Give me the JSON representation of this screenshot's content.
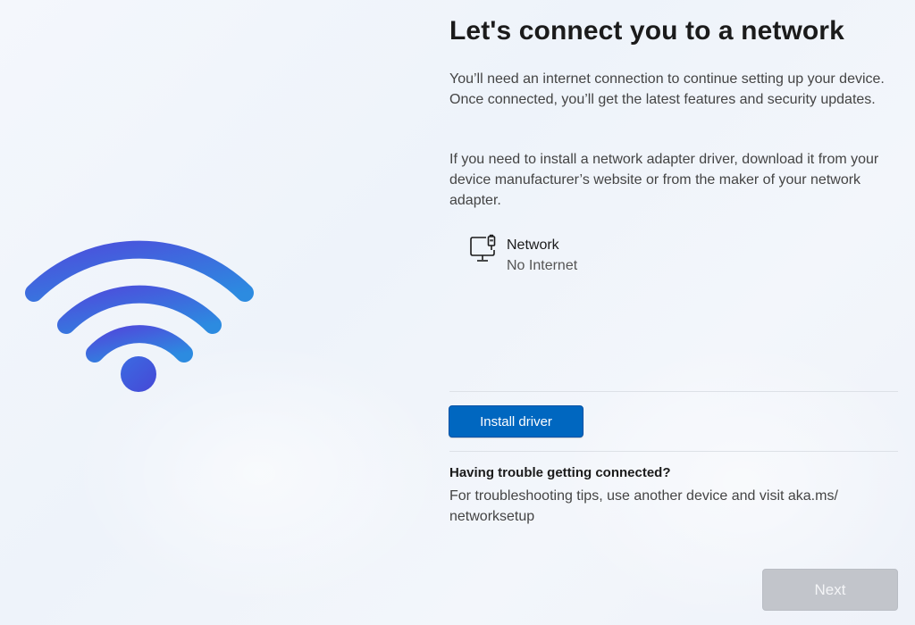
{
  "page": {
    "title": "Let's connect you to a network",
    "paragraph_1": "You’ll need an internet connection to continue setting up your device. Once connected, you’ll get the latest features and security updates.",
    "paragraph_2": "If you need to install a network adapter driver, download it from your device manufacturer’s website or from the maker of your network adapter."
  },
  "network": {
    "icon": "ethernet-monitor-icon",
    "name": "Network",
    "status": "No Internet"
  },
  "install_driver": {
    "label": "Install driver"
  },
  "troubleshoot": {
    "heading": "Having trouble getting connected?",
    "text": "For troubleshooting tips, use another device and visit aka.ms/ networksetup"
  },
  "footer": {
    "next_label": "Next",
    "next_enabled": false
  },
  "illustration": {
    "icon": "wifi-icon"
  },
  "colors": {
    "accent": "#0067c0",
    "wifi_gradient_start": "#4a55dd",
    "wifi_gradient_end": "#2f86de",
    "disabled_button": "#c2c5cb"
  }
}
